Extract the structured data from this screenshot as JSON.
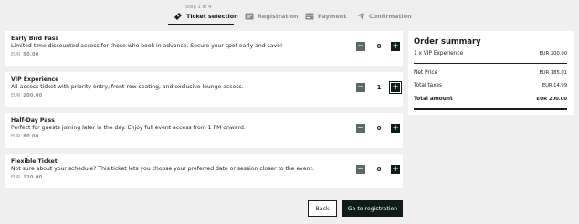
{
  "stepper": {
    "meta": "Step 1 of 4",
    "steps": [
      {
        "label": "Ticket selection",
        "icon": "ticket-icon",
        "active": true
      },
      {
        "label": "Registration",
        "icon": "registration-card-icon",
        "active": false
      },
      {
        "label": "Payment",
        "icon": "payment-card-icon",
        "active": false
      },
      {
        "label": "Confirmation",
        "icon": "send-icon",
        "active": false
      }
    ]
  },
  "tickets": [
    {
      "name": "Early Bird Pass",
      "description": "Limited-time discounted access for those who book in advance. Secure your spot early and save!",
      "currency": "EUR",
      "price": "50.00",
      "quantity": "0"
    },
    {
      "name": "VIP Experience",
      "description": "All-access ticket with priority entry, front-row seating, and exclusive lounge access.",
      "currency": "EUR",
      "price": "200.00",
      "quantity": "1"
    },
    {
      "name": "Half-Day Pass",
      "description": "Perfect for guests joining later in the day. Enjoy full event access from 1 PM onward.",
      "currency": "EUR",
      "price": "80.00",
      "quantity": "0"
    },
    {
      "name": "Flexible Ticket",
      "description": "Not sure about your schedule? This ticket lets you choose your preferred date or session closer to the event.",
      "currency": "EUR",
      "price": "120.00",
      "quantity": "0"
    }
  ],
  "quantity_controls": {
    "minus": "−",
    "plus": "+"
  },
  "summary": {
    "title": "Order summary",
    "line_item": {
      "label": "1 x VIP Experience",
      "value": "EUR 200.00"
    },
    "net_price": {
      "label": "Net Price",
      "value": "EUR 185.01"
    },
    "total_taxes": {
      "label": "Total taxes",
      "value": "EUR 14.99"
    },
    "total_amount": {
      "label": "Total amount",
      "value": "EUR 200.00"
    }
  },
  "footer": {
    "back_label": "Back",
    "next_label": "Go to registration"
  },
  "colors": {
    "page_bg": "#efefef",
    "primary": "#0f1d17",
    "minus_bg": "#5a6b64",
    "muted_text": "#8c8c8c"
  }
}
